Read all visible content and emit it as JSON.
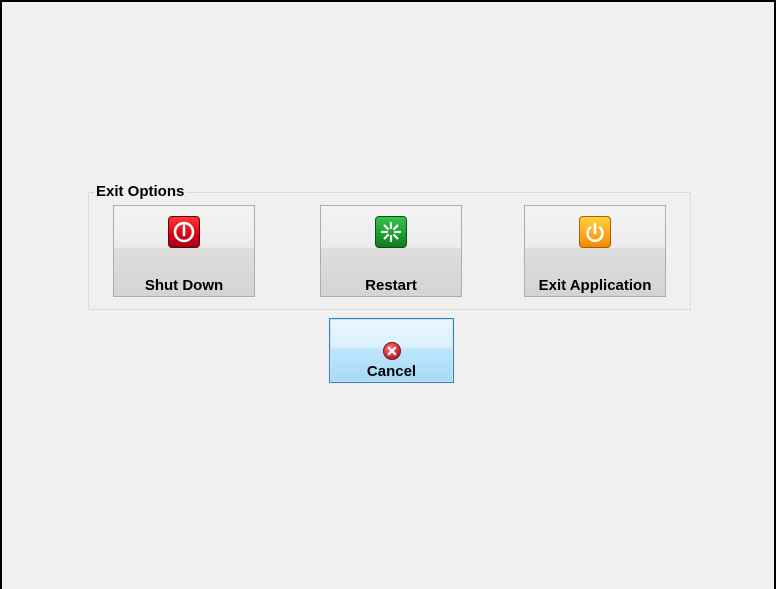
{
  "exit_options": {
    "title": "Exit Options",
    "buttons": [
      {
        "label": "Shut Down",
        "icon": "power-icon",
        "color": "#d0021b"
      },
      {
        "label": "Restart",
        "icon": "restart-icon",
        "color": "#1b9b30"
      },
      {
        "label": "Exit Application",
        "icon": "power-icon",
        "color": "#ffa41a"
      }
    ]
  },
  "cancel": {
    "label": "Cancel",
    "icon": "close-icon",
    "color": "#d9363e"
  }
}
